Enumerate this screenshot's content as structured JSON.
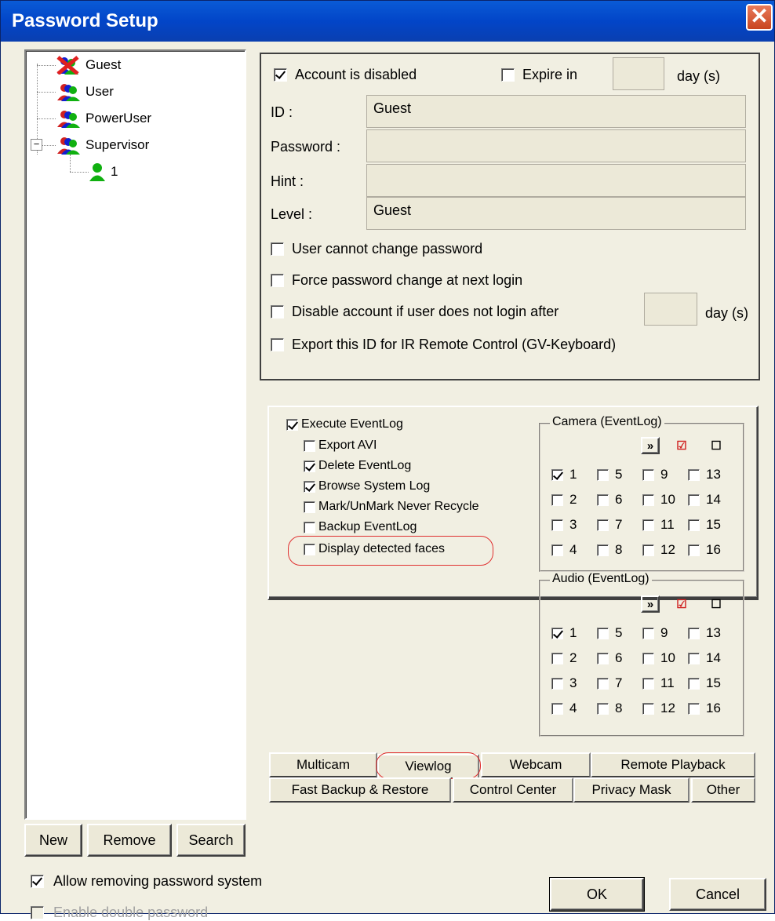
{
  "window": {
    "title": "Password Setup",
    "close_glyph": "✕"
  },
  "tree": {
    "items": [
      {
        "label": "Guest",
        "icon": "guest-disabled-users-icon"
      },
      {
        "label": "User",
        "icon": "users-group-icon"
      },
      {
        "label": "PowerUser",
        "icon": "users-group-icon"
      },
      {
        "label": "Supervisor",
        "icon": "users-group-icon",
        "expanded": true,
        "expander": "−"
      },
      {
        "label": "1",
        "icon": "single-user-icon"
      }
    ]
  },
  "tree_buttons": {
    "new": "New",
    "remove": "Remove",
    "search": "Search"
  },
  "account": {
    "disabled_label": "Account is disabled",
    "disabled_checked": true,
    "expire_label": "Expire in",
    "expire_checked": false,
    "expire_value": "",
    "expire_unit": "day (s)",
    "id_label": "ID :",
    "id_value": "Guest",
    "password_label": "Password :",
    "password_value": "",
    "hint_label": "Hint :",
    "hint_value": "",
    "level_label": "Level :",
    "level_value": "Guest",
    "options": [
      {
        "label": "User cannot change password",
        "checked": false
      },
      {
        "label": "Force password change at next login",
        "checked": false
      },
      {
        "label": "Disable account if user does not login after",
        "checked": false
      },
      {
        "label": "Export this ID for IR Remote Control (GV-Keyboard)",
        "checked": false
      }
    ],
    "login_days_value": "",
    "login_days_unit": "day (s)"
  },
  "viewlog": {
    "execute": {
      "label": "Execute EventLog",
      "checked": true
    },
    "perms": [
      {
        "label": "Export AVI",
        "checked": false
      },
      {
        "label": "Delete EventLog",
        "checked": true
      },
      {
        "label": "Browse System Log",
        "checked": true
      },
      {
        "label": "Mark/UnMark Never Recycle",
        "checked": false
      },
      {
        "label": "Backup EventLog",
        "checked": false
      },
      {
        "label": "Display detected faces",
        "checked": false
      }
    ],
    "camera_group": "Camera (EventLog)",
    "audio_group": "Audio (EventLog)",
    "tool_glyphs": {
      "expand": "»",
      "check_all": "☑",
      "uncheck_all": "☐"
    },
    "camera_channels": [
      {
        "n": "1",
        "c": true
      },
      {
        "n": "5",
        "c": false
      },
      {
        "n": "9",
        "c": false
      },
      {
        "n": "13",
        "c": false
      },
      {
        "n": "2",
        "c": false
      },
      {
        "n": "6",
        "c": false
      },
      {
        "n": "10",
        "c": false
      },
      {
        "n": "14",
        "c": false
      },
      {
        "n": "3",
        "c": false
      },
      {
        "n": "7",
        "c": false
      },
      {
        "n": "11",
        "c": false
      },
      {
        "n": "15",
        "c": false
      },
      {
        "n": "4",
        "c": false
      },
      {
        "n": "8",
        "c": false
      },
      {
        "n": "12",
        "c": false
      },
      {
        "n": "16",
        "c": false
      }
    ],
    "audio_channels": [
      {
        "n": "1",
        "c": true
      },
      {
        "n": "5",
        "c": false
      },
      {
        "n": "9",
        "c": false
      },
      {
        "n": "13",
        "c": false
      },
      {
        "n": "2",
        "c": false
      },
      {
        "n": "6",
        "c": false
      },
      {
        "n": "10",
        "c": false
      },
      {
        "n": "14",
        "c": false
      },
      {
        "n": "3",
        "c": false
      },
      {
        "n": "7",
        "c": false
      },
      {
        "n": "11",
        "c": false
      },
      {
        "n": "15",
        "c": false
      },
      {
        "n": "4",
        "c": false
      },
      {
        "n": "8",
        "c": false
      },
      {
        "n": "12",
        "c": false
      },
      {
        "n": "16",
        "c": false
      }
    ]
  },
  "tabs": {
    "row1": [
      "Multicam",
      "Viewlog",
      "Webcam",
      "Remote Playback"
    ],
    "row2": [
      "Fast Backup & Restore",
      "Control Center",
      "Privacy Mask",
      "Other"
    ],
    "active": "Viewlog"
  },
  "footer": {
    "allow_remove": {
      "label": "Allow removing password system",
      "checked": true
    },
    "double_pw": {
      "label": "Enable double password",
      "checked": false,
      "disabled": true
    },
    "ok": "OK",
    "cancel": "Cancel"
  },
  "colors": {
    "title_bar": "#0245c8",
    "highlight": "#e03030",
    "user_green": "#10b010",
    "user_blue": "#1020d0",
    "disabled_red": "#e02020"
  }
}
